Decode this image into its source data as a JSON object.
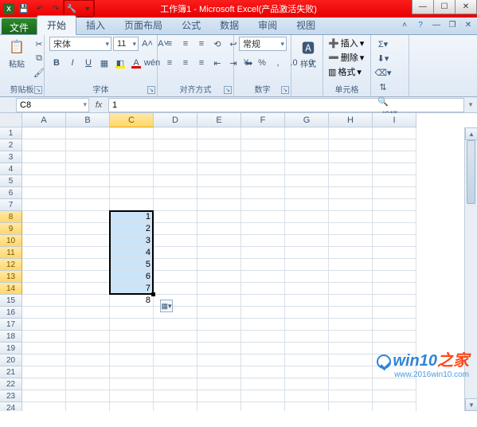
{
  "title": "工作簿1 - Microsoft Excel(产品激活失败)",
  "tabs": {
    "file": "文件",
    "list": [
      "开始",
      "插入",
      "页面布局",
      "公式",
      "数据",
      "审阅",
      "视图"
    ],
    "active_index": 0
  },
  "ribbon": {
    "clipboard": {
      "label": "剪贴板",
      "paste": "粘贴"
    },
    "font": {
      "label": "字体",
      "font_name": "宋体",
      "font_size": "11"
    },
    "alignment": {
      "label": "对齐方式"
    },
    "number": {
      "label": "数字",
      "format": "常规"
    },
    "styles": {
      "label": "样式"
    },
    "cells": {
      "label": "单元格",
      "insert": "插入",
      "delete": "删除",
      "format": "格式"
    },
    "editing": {
      "label": "编辑"
    }
  },
  "namebox": "C8",
  "formula": "1",
  "columns": [
    "A",
    "B",
    "C",
    "D",
    "E",
    "F",
    "G",
    "H",
    "I"
  ],
  "row_count": 24,
  "sel_col_index": 2,
  "sel_rows": [
    8,
    9,
    10,
    11,
    12,
    13,
    14
  ],
  "cell_data": {
    "C8": "1",
    "C9": "2",
    "C10": "3",
    "C11": "4",
    "C12": "5",
    "C13": "6",
    "C14": "7",
    "C15": "8"
  },
  "chart_data": {
    "type": "table",
    "selection": "C8:C14",
    "active_cell": "C8",
    "fill_preview_cell": "C15",
    "values": [
      1,
      2,
      3,
      4,
      5,
      6,
      7
    ]
  },
  "watermark": {
    "brand_a": "win10",
    "brand_b": "之家",
    "url": "www.2016win10.com"
  }
}
